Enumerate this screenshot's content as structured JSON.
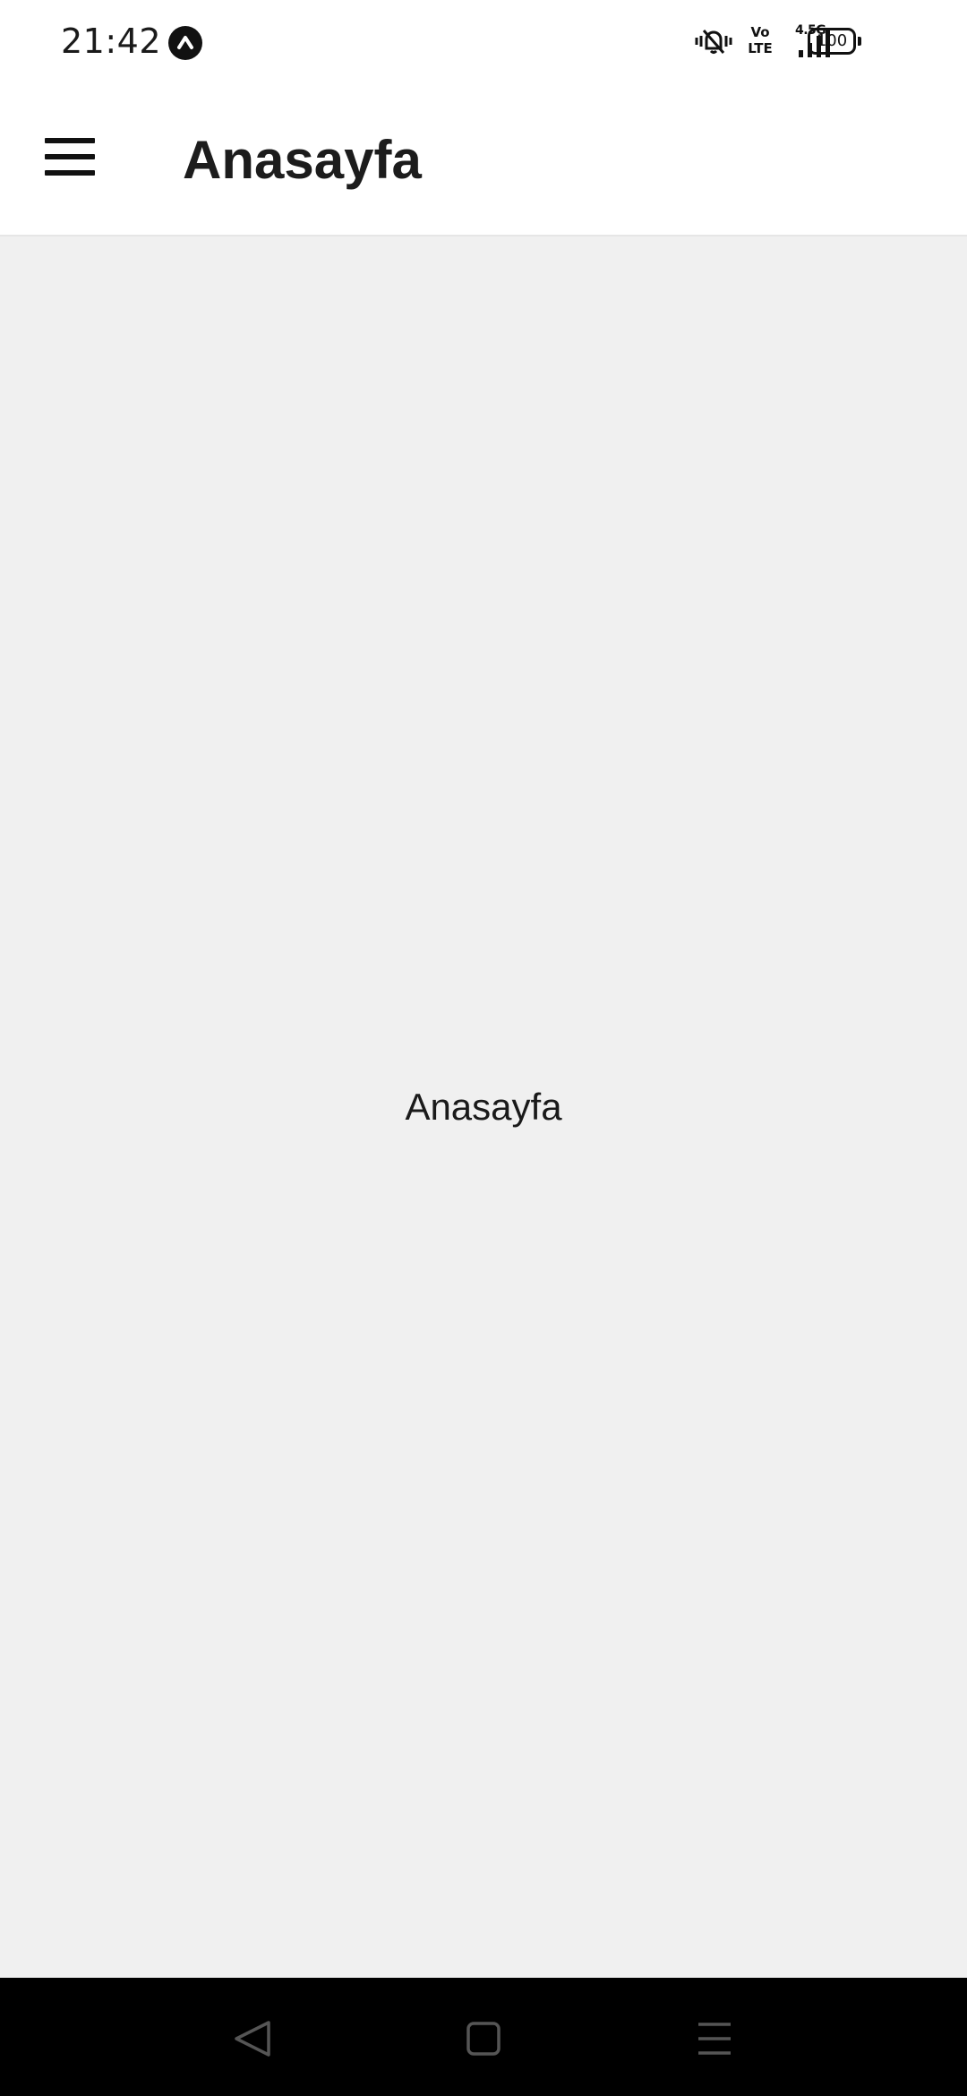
{
  "status_bar": {
    "time": "21:42",
    "network_label": "4.5G",
    "volte_line1": "Vo",
    "volte_line2": "LTE",
    "battery_level": "100"
  },
  "app_bar": {
    "title": "Anasayfa",
    "menu_icon": "hamburger-menu-icon"
  },
  "content": {
    "text": "Anasayfa",
    "background": "#f0f0f0"
  },
  "nav_bar": {
    "buttons": [
      "back-icon",
      "home-icon",
      "recents-icon"
    ]
  }
}
